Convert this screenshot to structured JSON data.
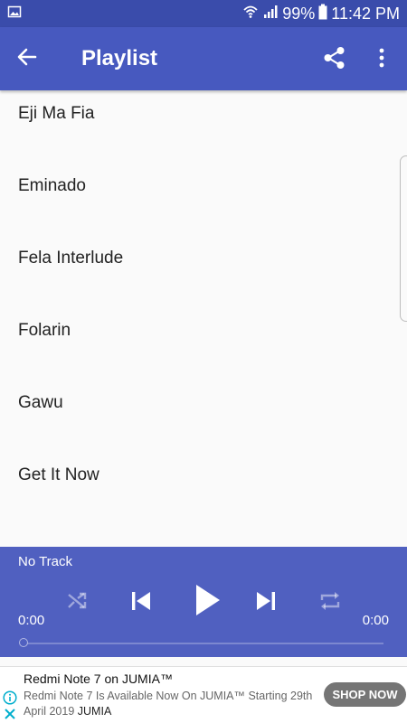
{
  "status_bar": {
    "battery": "99%",
    "time": "11:42 PM",
    "icons": [
      "image-icon",
      "wifi-icon",
      "signal-icon",
      "battery-icon"
    ]
  },
  "app_bar": {
    "title": "Playlist",
    "background": "#4759bf",
    "icons": [
      "back-arrow-icon",
      "share-icon",
      "more-vert-icon"
    ]
  },
  "tracks": [
    "Eji Ma Fia",
    "Eminado",
    "Fela Interlude",
    "Folarin",
    "Gawu",
    "Get It Now"
  ],
  "player": {
    "now_playing": "No Track",
    "elapsed": "0:00",
    "duration": "0:00",
    "progress": 0,
    "background": "#5060c0",
    "controls": [
      "shuffle-icon",
      "previous-icon",
      "play-icon",
      "next-icon",
      "repeat-icon"
    ]
  },
  "ad": {
    "title": "Redmi Note 7 on JUMIA™",
    "body": "Redmi Note 7 Is Available Now On JUMIA™ Starting 29th April 2019",
    "brand": "JUMIA",
    "cta": "SHOP NOW",
    "icons": [
      "ad-info-icon",
      "ad-close-icon"
    ]
  }
}
